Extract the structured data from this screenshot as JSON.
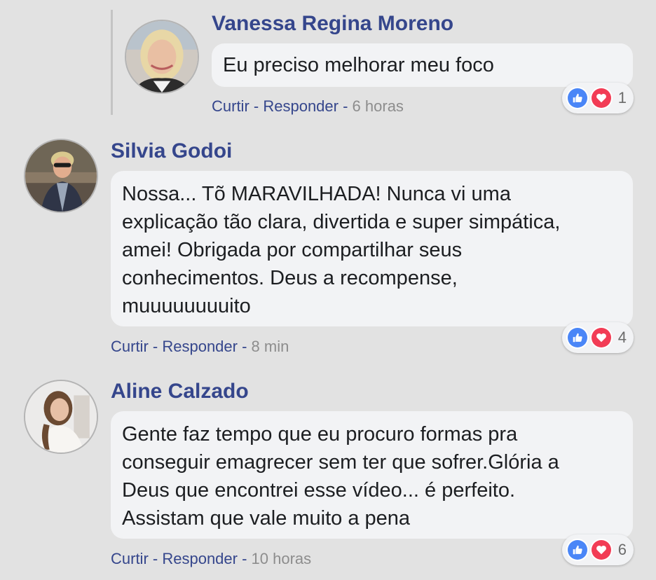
{
  "comments": [
    {
      "author": "Vanessa Regina Moreno",
      "text": "Eu preciso melhorar meu foco",
      "like_label": "Curtir",
      "reply_label": "Responder",
      "separator": " - ",
      "time": "6 horas",
      "reaction_count": "1",
      "reactions": [
        "like-icon",
        "love-icon"
      ]
    },
    {
      "author": "Silvia Godoi",
      "text": "Nossa... Tõ MARAVILHADA! Nunca vi uma\nexplicação tão clara, divertida e super simpática,\namei! Obrigada por compartilhar seus\nconhecimentos. Deus a recompense,\nmuuuuuuuuito",
      "like_label": "Curtir",
      "reply_label": "Responder",
      "separator": " - ",
      "time": "8 min",
      "reaction_count": "4",
      "reactions": [
        "like-icon",
        "love-icon"
      ]
    },
    {
      "author": "Aline Calzado",
      "text": "Gente faz tempo que eu procuro formas pra\nconseguir emagrecer sem ter que sofrer.Glória a\nDeus que encontrei esse vídeo... é perfeito.\nAssistam que vale muito a pena",
      "like_label": "Curtir",
      "reply_label": "Responder",
      "separator": " - ",
      "time": "10 horas",
      "reaction_count": "6",
      "reactions": [
        "like-icon",
        "love-icon"
      ]
    }
  ],
  "colors": {
    "background": "#e2e2e2",
    "author": "#35468c",
    "bubble": "#f2f3f5",
    "like": "#4a86f7",
    "love": "#f23c55",
    "time": "#8d8d8d"
  }
}
